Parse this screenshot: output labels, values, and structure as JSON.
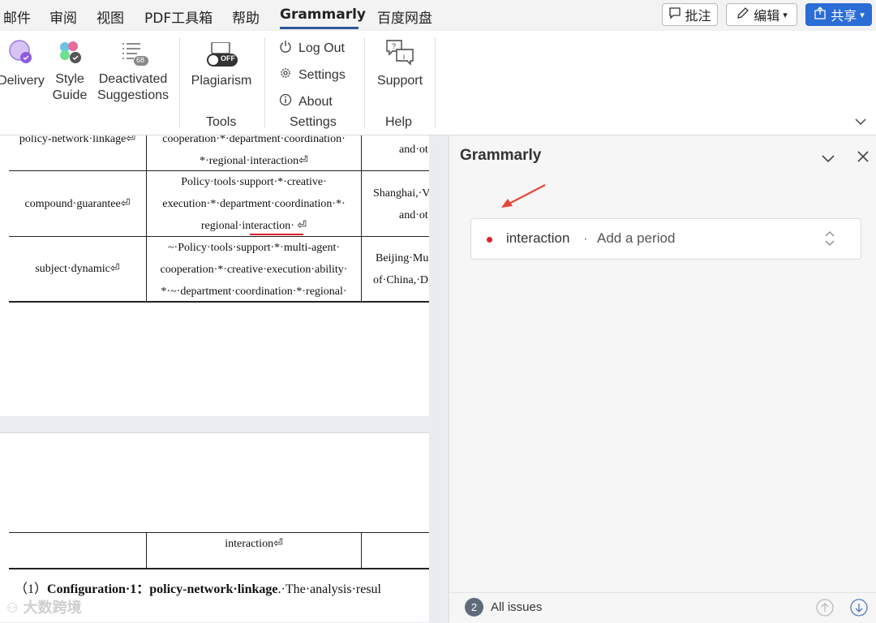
{
  "menubar": {
    "tabs": [
      "邮件",
      "审阅",
      "视图",
      "PDF工具箱",
      "帮助",
      "Grammarly",
      "百度网盘"
    ],
    "comment_label": "批注",
    "edit_label": "编辑",
    "share_label": "共享"
  },
  "ribbon": {
    "delivery": "Delivery",
    "style_guide_1": "Style",
    "style_guide_2": "Guide",
    "deactivated_1": "Deactivated",
    "deactivated_2": "Suggestions",
    "deactivated_badge": "68",
    "plagiarism": "Plagiarism",
    "plagiarism_toggle": "OFF",
    "log_out": "Log Out",
    "settings": "Settings",
    "about": "About",
    "support": "Support",
    "group_tools": "Tools",
    "group_settings": "Settings",
    "group_help": "Help"
  },
  "document": {
    "rows": [
      {
        "col1": "policy-network·linkage⏎",
        "col2a": "cooperation·*·department·coordination·",
        "col2b": "*·regional·interaction⏎",
        "col3a": "",
        "col3b": "and·ot"
      },
      {
        "col1": "compound·guarantee⏎",
        "col2a": "Policy·tools·support·*·creative·",
        "col2b": "execution·*·department·coordination·*·",
        "col2c": "regional·interaction· ⏎",
        "col3a": "Shanghai,·V",
        "col3b": "and·ot"
      },
      {
        "col1": "subject·dynamic⏎",
        "col2a": "~·Policy·tools·support·*·multi-agent·",
        "col2b": "cooperation·*·creative·execution·ability·",
        "col2c": "*·~·department·coordination·*·regional·",
        "col3a": "Beijing·Mu",
        "col3b": "of·China,·D"
      }
    ],
    "page2_cell": "interaction⏎",
    "para_prefix": "（1）",
    "para_bold": "Configuration·1：policy-network·linkage",
    "para_rest": ".·The·analysis·resul"
  },
  "grammarly": {
    "title": "Grammarly",
    "issue_word": "interaction",
    "issue_sep": "·",
    "issue_suggestion": "Add a period",
    "issue_color": "#e0202e",
    "issues_count": "2",
    "all_issues_label": "All issues"
  },
  "watermark": "大数跨境",
  "colors": {
    "accent": "#2b579a",
    "share": "#2b6cd6",
    "error": "#e0202e"
  }
}
